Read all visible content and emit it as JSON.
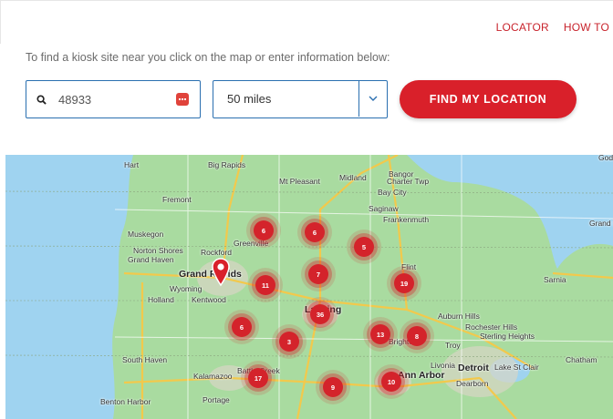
{
  "nav": {
    "locator": "LOCATOR",
    "howto": "HOW TO"
  },
  "instruction": "To find a kiosk site near you click on the map or enter information below:",
  "search": {
    "value": "48933"
  },
  "distance": {
    "value": "50 miles"
  },
  "find_button": "FIND MY LOCATION",
  "colors": {
    "accent": "#d9202a",
    "input_border": "#2a6fb0",
    "map_land": "#a9dba0",
    "water": "#9fd3f0"
  },
  "map_labels": [
    "Hart",
    "Big Rapids",
    "Mt Pleasant",
    "Midland",
    "Bangor",
    "Charter Twp",
    "Bay City",
    "Fremont",
    "Saginaw",
    "Frankenmuth",
    "Muskegon",
    "Greenville",
    "Norton Shores",
    "Rockford",
    "Grand Haven",
    "Grand Rapids",
    "Wyoming",
    "Kentwood",
    "Holland",
    "Flint",
    "Sarnia",
    "Lansing",
    "Auburn Hills",
    "Rochester Hills",
    "Sterling Heights",
    "Brighton",
    "Troy",
    "South Haven",
    "Kalamazoo",
    "Battle Creek",
    "Portage",
    "Ann Arbor",
    "Livonia",
    "Detroit",
    "Dearborn",
    "Chatham",
    "Benton Harbor",
    "Goderich",
    "Grand Bend",
    "Lake St Clair"
  ],
  "clusters": [
    "6",
    "6",
    "5",
    "7",
    "11",
    "19",
    "36",
    "6",
    "13",
    "8",
    "3",
    "17",
    "9",
    "10"
  ]
}
